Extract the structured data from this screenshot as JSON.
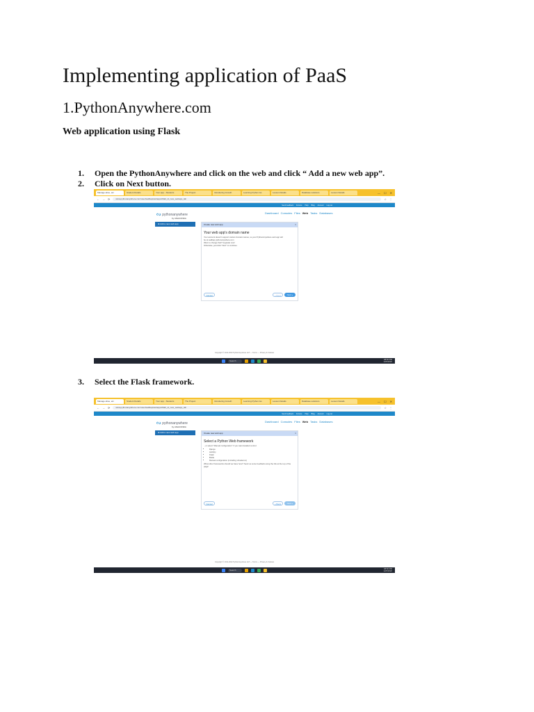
{
  "document": {
    "title": "Implementing application of PaaS",
    "subtitle": "1.PythonAnywhere.com",
    "section": "Web application using Flask",
    "steps": [
      {
        "num": "1.",
        "text": "Open the PythonAnywhere and click on the web and click “ Add a new web app”."
      },
      {
        "num": "2.",
        "text": "Click on Next button."
      },
      {
        "num": "3.",
        "text": "Select the Flask framework."
      }
    ]
  },
  "screenshot1": {
    "tabs": [
      "Manage abse, etc",
      "Student Details",
      "Your app - Students",
      "The Project",
      "Introducing Growth",
      "Learning Python Iss",
      "Lesson Details",
      "Database solutions",
      "Lesson Details"
    ],
    "address": "www.pythonanywhere.com/user/sadbap/webapps/#tab_id_new_webapp_tab",
    "top_links": [
      "Send feedback",
      "Forums",
      "Help",
      "Blog",
      "Account",
      "Log out"
    ],
    "logo": "pythonanywhere",
    "logo_by": "by ANACONDA",
    "nav": [
      "Dashboard",
      "Consoles",
      "Files",
      "Web",
      "Tasks",
      "Databases"
    ],
    "side_button": "Add a new web app",
    "panel_head": "Create new web app",
    "panel_title": "Your web app's domain name",
    "panel_lines": [
      "Your account doesn't support custom domain names, so your PythonAnywhere web app will",
      "be at sadbap.pythonanywhere.com",
      "Want to change that? Upgrade now!",
      "Otherwise, just click \"Next\" to continue."
    ],
    "btn_cancel": "Cancel",
    "btn_back": "« Back",
    "btn_next": "Next »",
    "footer": "Copyright © 2011-2022 PythonAnywhere LLP — Terms — Privacy & Cookies",
    "search": "Search",
    "tray_time": "08:50 PM",
    "tray_date": "12/6/2022"
  },
  "screenshot2": {
    "tabs": [
      "Manage abse, etc",
      "Student Details",
      "Your app - Students",
      "The Project",
      "Introducing Growth",
      "Learning Python Iss",
      "Lesson Details",
      "Database solutions",
      "Lesson Details"
    ],
    "address": "www.pythonanywhere.com/user/sadbap/webapps/#tab_id_new_webapp_tab",
    "top_links": [
      "Send feedback",
      "Forums",
      "Help",
      "Blog",
      "Account",
      "Log out"
    ],
    "logo": "pythonanywhere",
    "logo_by": "by ANACONDA",
    "nav": [
      "Dashboard",
      "Consoles",
      "Files",
      "Web",
      "Tasks",
      "Databases"
    ],
    "side_button": "Add a new web app",
    "panel_head": "Create new web app",
    "panel_title": "Select a Python Web framework",
    "panel_intro": "...or select \"Manual configuration\" if you want detailed control.",
    "frameworks": [
      "Django",
      "web2py",
      "Flask",
      "Bottle",
      "Manual configuration (including virtualenvs)"
    ],
    "panel_outro": "What other frameworks should we have here? Send us some feedback using the link at the top of the page!",
    "btn_cancel": "Cancel",
    "btn_back": "« Back",
    "btn_next": "Next »",
    "footer": "Copyright © 2011-2022 PythonAnywhere LLP — Terms — Privacy & Cookies",
    "search": "Search",
    "tray_time": "08:50 PM",
    "tray_date": "12/6/2022"
  }
}
